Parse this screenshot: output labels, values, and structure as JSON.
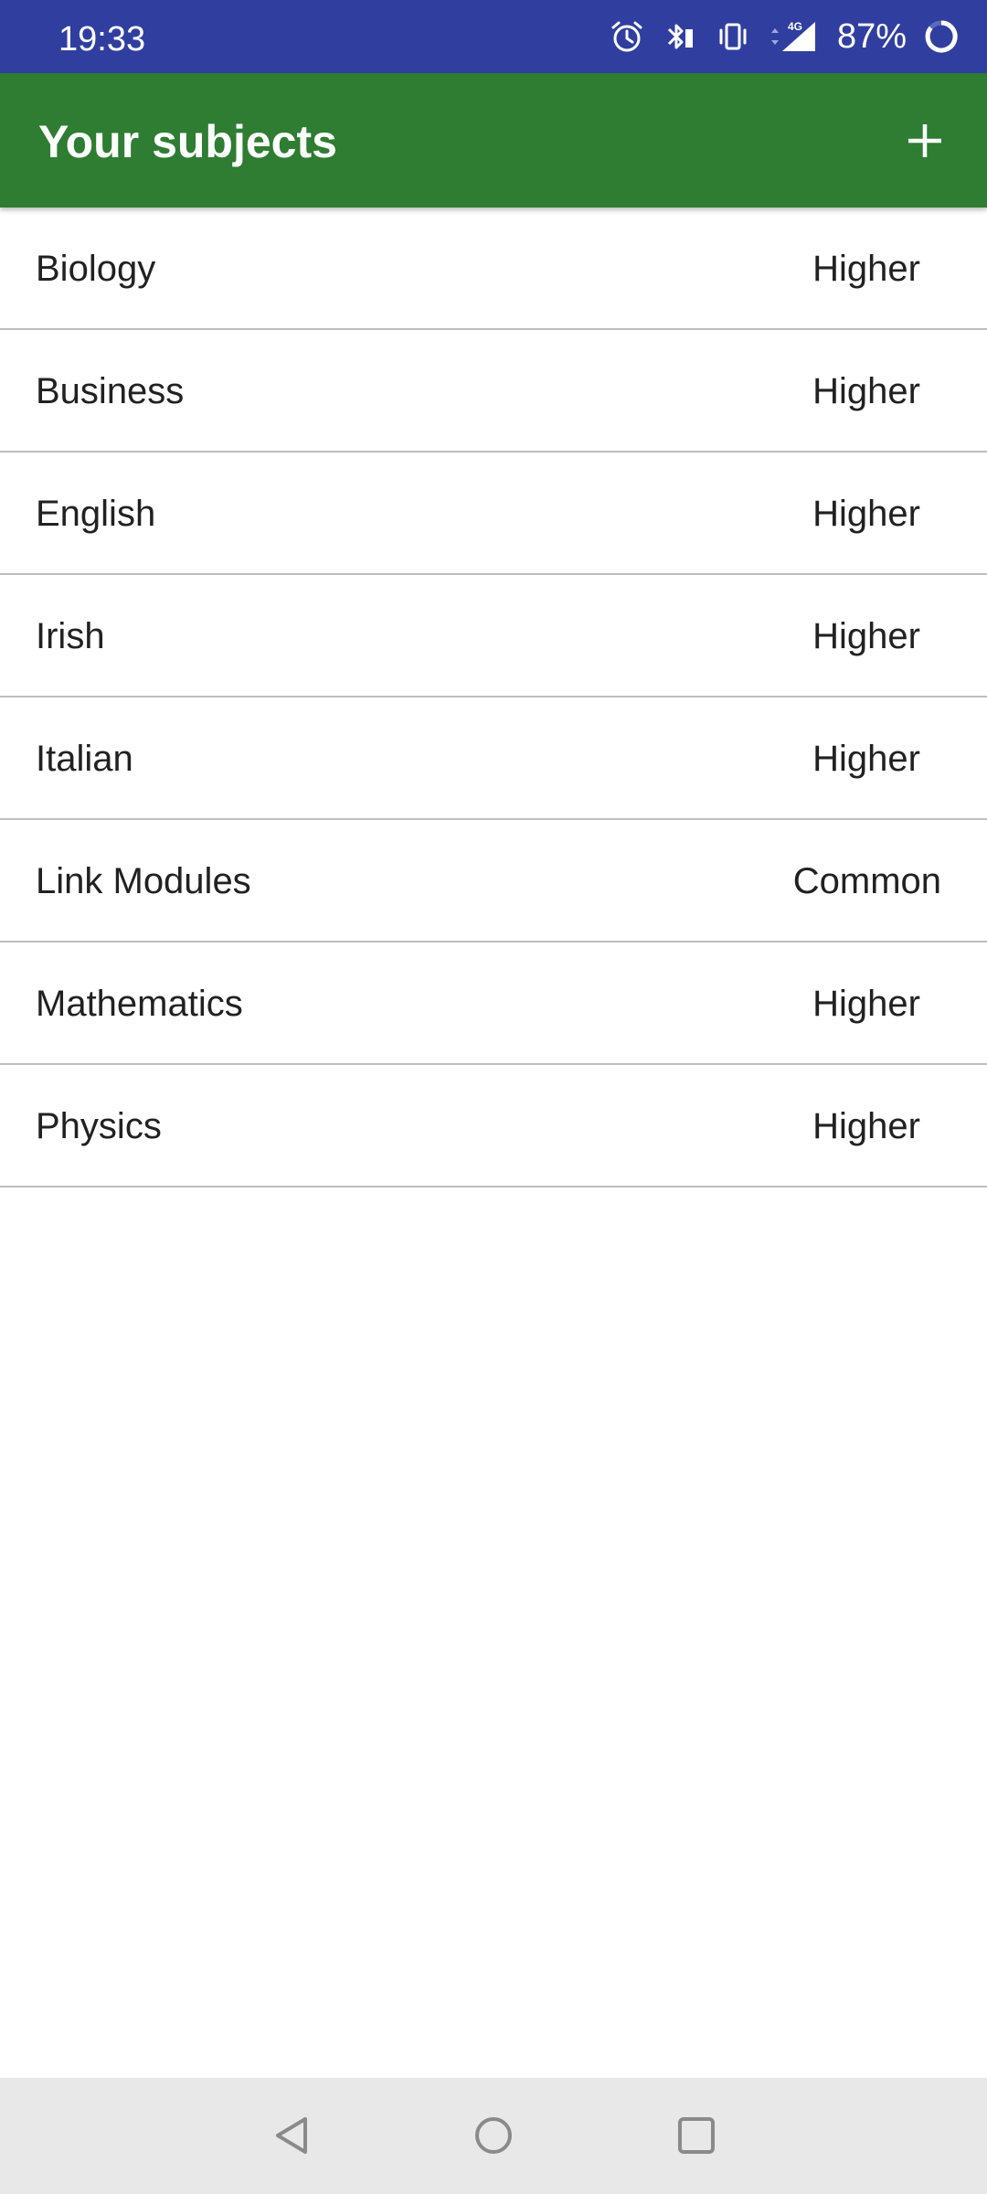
{
  "status_bar": {
    "time": "19:33",
    "battery_percent": "87%",
    "network_type": "4G",
    "icons": [
      "alarm-icon",
      "bluetooth-icon",
      "vibrate-icon",
      "signal-icon",
      "battery-icon"
    ]
  },
  "app_bar": {
    "title": "Your subjects",
    "add_icon": "plus-icon"
  },
  "subjects": [
    {
      "name": "Biology",
      "level": "Higher"
    },
    {
      "name": "Business",
      "level": "Higher"
    },
    {
      "name": "English",
      "level": "Higher"
    },
    {
      "name": "Irish",
      "level": "Higher"
    },
    {
      "name": "Italian",
      "level": "Higher"
    },
    {
      "name": "Link Modules",
      "level": "Common"
    },
    {
      "name": "Mathematics",
      "level": "Higher"
    },
    {
      "name": "Physics",
      "level": "Higher"
    }
  ],
  "nav_bar": {
    "icons": [
      "back-icon",
      "home-icon",
      "recents-icon"
    ]
  },
  "colors": {
    "status_bar": "#303f9f",
    "app_bar": "#2e7d32",
    "divider": "#bdbdbd",
    "nav_bar": "#e8e8e8"
  }
}
